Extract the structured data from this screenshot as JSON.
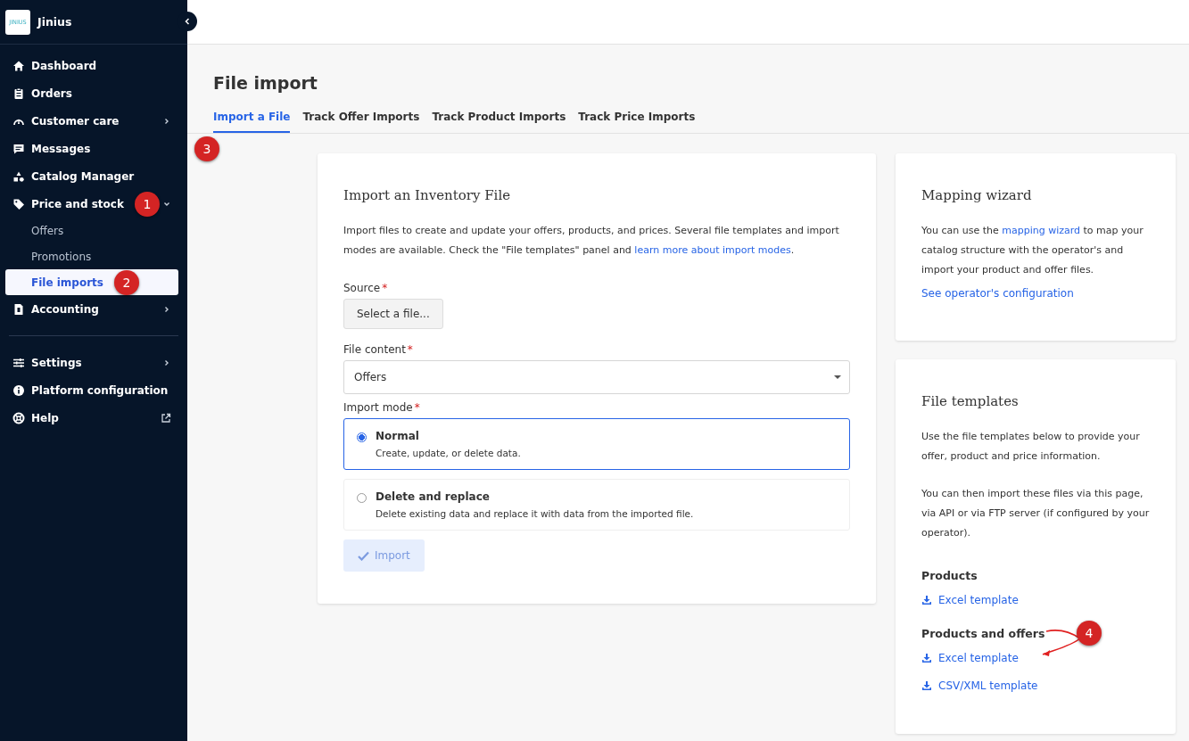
{
  "sidebar": {
    "logo_text": "JINIUS",
    "brand": "Jinius",
    "groups": [
      [
        {
          "label": "Dashboard"
        },
        {
          "label": "Orders"
        },
        {
          "label": "Customer care",
          "expanded": false
        },
        {
          "label": "Messages"
        },
        {
          "label": "Catalog Manager"
        },
        {
          "label": "Price and stock",
          "expanded": true,
          "callout": "1",
          "children": [
            {
              "label": "Offers",
              "selected": false
            },
            {
              "label": "Promotions",
              "selected": false
            },
            {
              "label": "File imports",
              "selected": true,
              "callout": "2"
            }
          ]
        },
        {
          "label": "Accounting",
          "expanded": false
        }
      ],
      [
        {
          "label": "Settings",
          "expanded": false
        },
        {
          "label": "Platform configuration"
        },
        {
          "label": "Help",
          "external": true
        }
      ]
    ]
  },
  "page": {
    "title": "File import",
    "tabs": [
      {
        "label": "Import a File",
        "selected": true
      },
      {
        "label": "Track Offer Imports",
        "selected": false
      },
      {
        "label": "Track Product Imports",
        "selected": false
      },
      {
        "label": "Track Price Imports",
        "selected": false
      }
    ],
    "tabs_callout": "3"
  },
  "import_card": {
    "title": "Import an Inventory File",
    "description": "Import files to create and update your offers, products, and prices. Several file templates and import modes are available. Check the \"File templates\" panel and ",
    "description_link": "learn more about import modes",
    "description_end": ".",
    "source_label": "Source",
    "required_mark": "*",
    "source_button": "Select a file...",
    "content_label": "File content",
    "content_value": "Offers",
    "mode_label": "Import mode",
    "modes": [
      {
        "title": "Normal",
        "description": "Create, update, or delete data.",
        "selected": true
      },
      {
        "title": "Delete and replace",
        "description": "Delete existing data and replace it with data from the imported file.",
        "selected": false
      }
    ],
    "import_button": {
      "label": "Import",
      "disabled": true
    }
  },
  "mapping_card": {
    "title": "Mapping wizard",
    "text_before": "You can use the ",
    "link": "mapping wizard",
    "text_after": " to map your catalog structure with the operator's and import your product and offer files.",
    "config_link": "See operator's configuration"
  },
  "templates_card": {
    "title": "File templates",
    "paragraphs": [
      "Use the file templates below to provide your offer, product and price information.",
      "You can then import these files via this page, via API or via FTP server (if configured by your operator)."
    ],
    "sections": [
      {
        "heading": "Products",
        "links": [
          "Excel template"
        ]
      },
      {
        "heading": "Products and offers",
        "callout": "4",
        "links": [
          "Excel template",
          "CSV/XML template"
        ]
      }
    ]
  }
}
